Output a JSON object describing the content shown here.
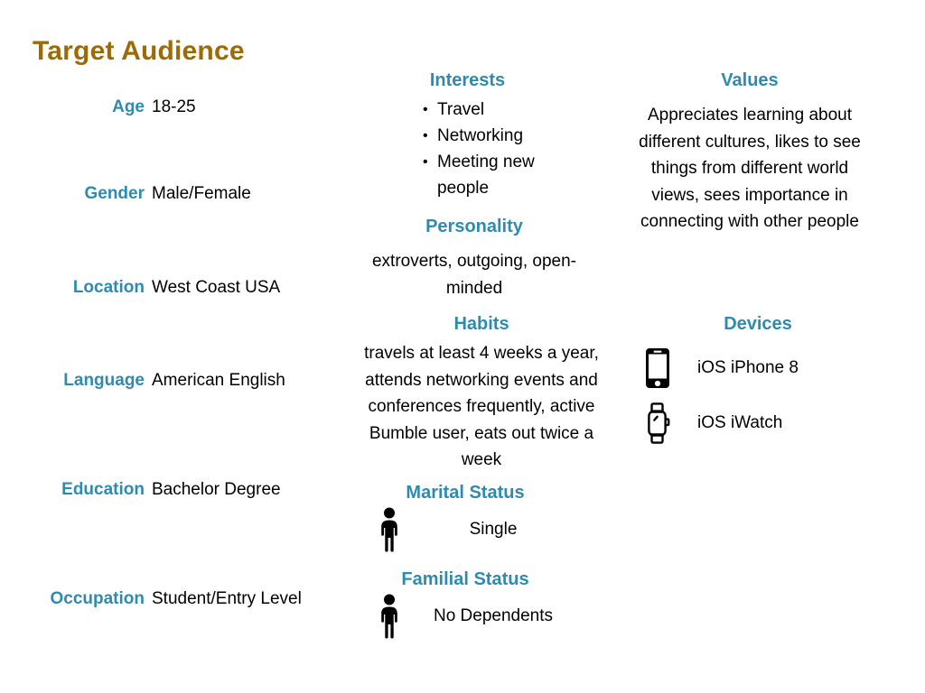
{
  "title": "Target Audience",
  "theme": {
    "title_color": "#9c6b06",
    "heading_color": "#2e8bb0",
    "text_color": "#000000",
    "background": "#ffffff"
  },
  "attributes": [
    {
      "label": "Age",
      "value": "18-25"
    },
    {
      "label": "Gender",
      "value": "Male/Female"
    },
    {
      "label": "Location",
      "value": "West Coast USA"
    },
    {
      "label": "Language",
      "value": "American English"
    },
    {
      "label": "Education",
      "value": "Bachelor Degree"
    },
    {
      "label": "Occupation",
      "value": "Student/Entry Level"
    }
  ],
  "interests": {
    "heading": "Interests",
    "items": [
      "Travel",
      "Networking",
      "Meeting new people"
    ]
  },
  "personality": {
    "heading": "Personality",
    "text": "extroverts, outgoing, open-minded"
  },
  "habits": {
    "heading": "Habits",
    "text": "travels at least 4 weeks a year, attends networking events and conferences frequently, active Bumble user, eats out twice a week"
  },
  "marital_status": {
    "heading": "Marital Status",
    "icon": "person-icon",
    "value": "Single"
  },
  "familial_status": {
    "heading": "Familial Status",
    "icon": "person-icon",
    "value": "No Dependents"
  },
  "values": {
    "heading": "Values",
    "text": "Appreciates learning about different cultures, likes to see things from different world views, sees importance in connecting with other people"
  },
  "devices": {
    "heading": "Devices",
    "items": [
      {
        "icon": "smartphone-icon",
        "label": "iOS iPhone 8"
      },
      {
        "icon": "smartwatch-icon",
        "label": "iOS iWatch"
      }
    ]
  }
}
